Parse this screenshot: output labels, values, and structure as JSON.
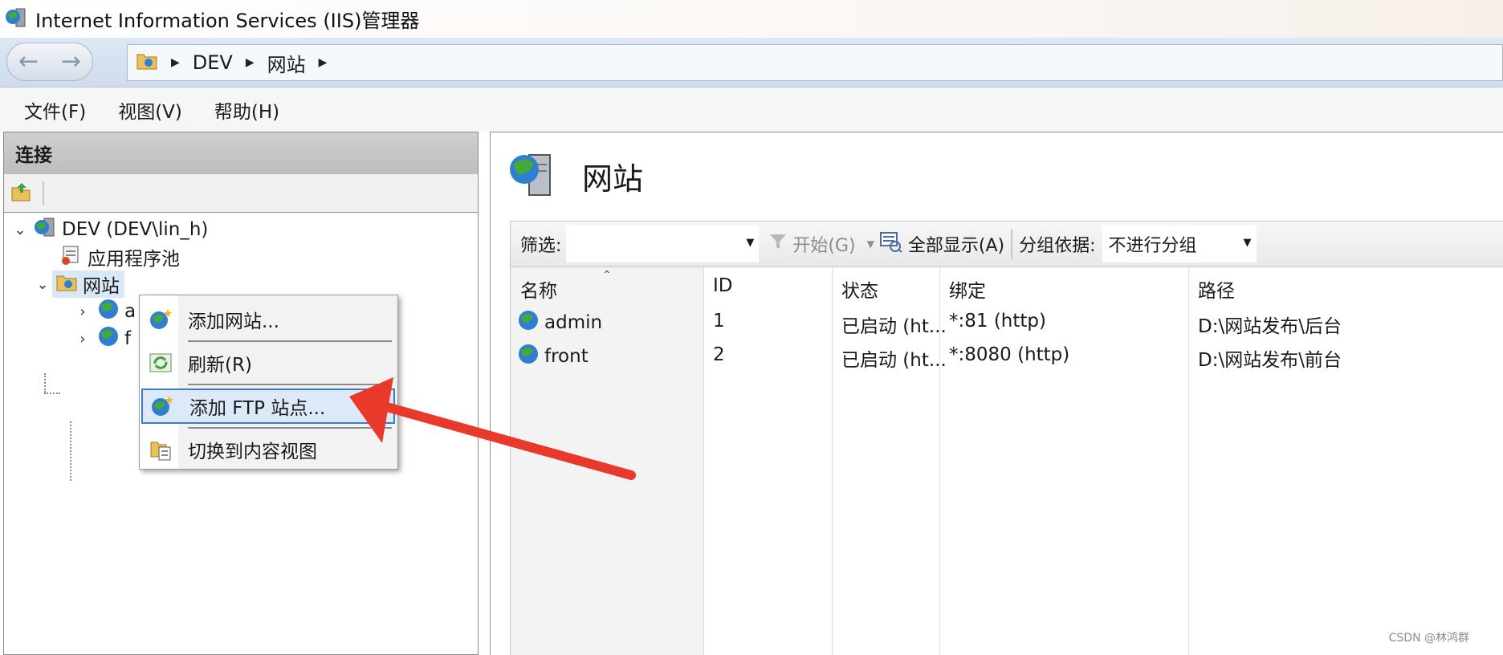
{
  "window": {
    "title": "Internet Information Services (IIS)管理器"
  },
  "address": {
    "segments": [
      "DEV",
      "网站"
    ]
  },
  "menu": {
    "items": [
      "文件(F)",
      "视图(V)",
      "帮助(H)"
    ]
  },
  "connections": {
    "header": "连接",
    "tree": {
      "server": "DEV (DEV\\lin_h)",
      "app_pool": "应用程序池",
      "sites": "网站",
      "children": [
        {
          "label": "a"
        },
        {
          "label": "f"
        }
      ]
    }
  },
  "context_menu": {
    "items": [
      {
        "label": "添加网站..."
      },
      {
        "label": "刷新(R)"
      },
      {
        "label": "添加 FTP 站点..."
      },
      {
        "label": "切换到内容视图"
      }
    ],
    "highlighted_index": 2
  },
  "main": {
    "title": "网站",
    "filter": {
      "label": "筛选:",
      "value": "",
      "start": "开始(G)",
      "show_all": "全部显示(A)",
      "group_label": "分组依据:",
      "group_value": "不进行分组"
    },
    "columns": [
      "名称",
      "ID",
      "状态",
      "绑定",
      "路径"
    ],
    "rows": [
      {
        "name": "admin",
        "id": "1",
        "status": "已启动 (ht...",
        "binding": "*:81 (http)",
        "path": "D:\\网站发布\\后台"
      },
      {
        "name": "front",
        "id": "2",
        "status": "已启动 (ht...",
        "binding": "*:8080 (http)",
        "path": "D:\\网站发布\\前台"
      }
    ]
  },
  "watermark": "CSDN @林鸿群",
  "colors": {
    "annotation_arrow": "#e8392a",
    "menu_highlight": "#dce9f8",
    "menu_highlight_border": "#3e7bc4"
  }
}
